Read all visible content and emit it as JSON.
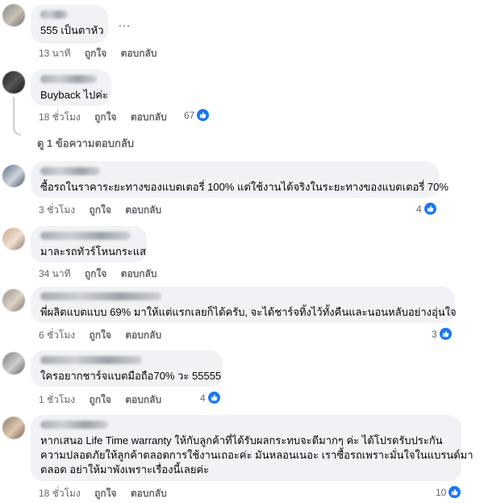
{
  "comments": [
    {
      "text": "555 เป็นตาหัว",
      "time": "13 นาที",
      "like": "ถูกใจ",
      "reply": "ตอบกลับ",
      "reactions": ""
    },
    {
      "text": "Buyback ไปค่ะ",
      "time": "18 ชั่วโมง",
      "like": "ถูกใจ",
      "reply": "ตอบกลับ",
      "reactions": "67"
    },
    {
      "text": "ซื้อรถในราคาระยะทางของแบตเตอรี่ 100% แต่ใช้งานได้จริงในระยะทางของแบตเตอรี่ 70%",
      "time": "3 ชั่วโมง",
      "like": "ถูกใจ",
      "reply": "ตอบกลับ",
      "reactions": "4"
    },
    {
      "text": "มาละรถทัวร์โหนกระแส",
      "time": "34 นาที",
      "like": "ถูกใจ",
      "reply": "ตอบกลับ",
      "reactions": ""
    },
    {
      "text": "พี่ผลิตแบตแบบ 69% มาให้แต่แรกเลยก็ได้ครับ, จะได้ชาร์จทิ้งไว้ทั้งคืนและนอนหลับอย่างอุ่นใจ",
      "time": "6 ชั่วโมง",
      "like": "ถูกใจ",
      "reply": "ตอบกลับ",
      "reactions": "3"
    },
    {
      "text": "ใครอยากชาร์จแบตมือถือ70% วะ 55555",
      "time": "1 ชั่วโมง",
      "like": "ถูกใจ",
      "reply": "ตอบกลับ",
      "reactions": "4"
    },
    {
      "text_lines": [
        "หากเสนอ Life Time warranty ให้กับลูกค้าที่ได้รับผลกระทบจะดีมากๆ ค่ะ ได้โปรดรับประกัน",
        "ความปลอดภัยให้ลูกค้าตลอดการใช้งานเถอะค่ะ มันหลอนเนอะ เราซื้อรถเพราะมั่นใจในแบรนด์มา",
        "ตลอด อย่าให้มาพังเพราะเรื่องนี้เลยค่ะ"
      ],
      "time": "18 ชั่วโมง",
      "like": "ถูกใจ",
      "reply": "ตอบกลับ",
      "reactions": "10"
    }
  ],
  "view_replies": "ดู 1 ข้อความตอบกลับ",
  "more_icon": "…",
  "colors": {
    "like": "#1877f2",
    "bubble": "#f0f2f5",
    "meta": "#65676b"
  }
}
